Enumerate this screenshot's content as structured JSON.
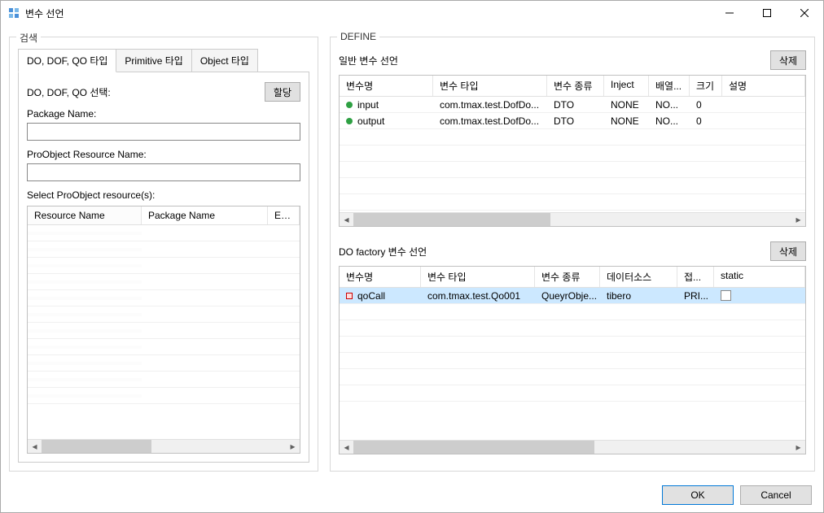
{
  "window": {
    "title": "변수 선언"
  },
  "search": {
    "group_title": "검색",
    "tabs": {
      "tab1": "DO, DOF, QO 타입",
      "tab2": "Primitive 타입",
      "tab3": "Object 타입"
    },
    "select_label": "DO, DOF, QO 선택:",
    "assign_btn": "할당",
    "package_name_label": "Package Name:",
    "resource_name_label": "ProObject Resource Name:",
    "select_resources_label": "Select ProObject resource(s):",
    "resource_table": {
      "col1": "Resource Name",
      "col2": "Package Name",
      "col3": "Exter"
    }
  },
  "define": {
    "group_title": "DEFINE",
    "general_section": {
      "title": "일반 변수 선언",
      "delete_btn": "삭제",
      "headers": {
        "c1": "변수명",
        "c2": "변수 타입",
        "c3": "변수 종류",
        "c4": "Inject",
        "c5": "배열...",
        "c6": "크기",
        "c7": "설명"
      },
      "rows": [
        {
          "name": "input",
          "type": "com.tmax.test.DofDo...",
          "kind": "DTO",
          "inject": "NONE",
          "array": "NO...",
          "size": "0",
          "desc": ""
        },
        {
          "name": "output",
          "type": "com.tmax.test.DofDo...",
          "kind": "DTO",
          "inject": "NONE",
          "array": "NO...",
          "size": "0",
          "desc": ""
        }
      ]
    },
    "factory_section": {
      "title": "DO factory 변수 선언",
      "delete_btn": "삭제",
      "headers": {
        "c1": "변수명",
        "c2": "변수 타입",
        "c3": "변수 종류",
        "c4": "데이터소스",
        "c5": "접...",
        "c6": "static"
      },
      "rows": [
        {
          "name": "qoCall",
          "type": "com.tmax.test.Qo001",
          "kind": "QueyrObje...",
          "datasource": "tibero",
          "access": "PRI..."
        }
      ]
    }
  },
  "footer": {
    "ok": "OK",
    "cancel": "Cancel"
  }
}
